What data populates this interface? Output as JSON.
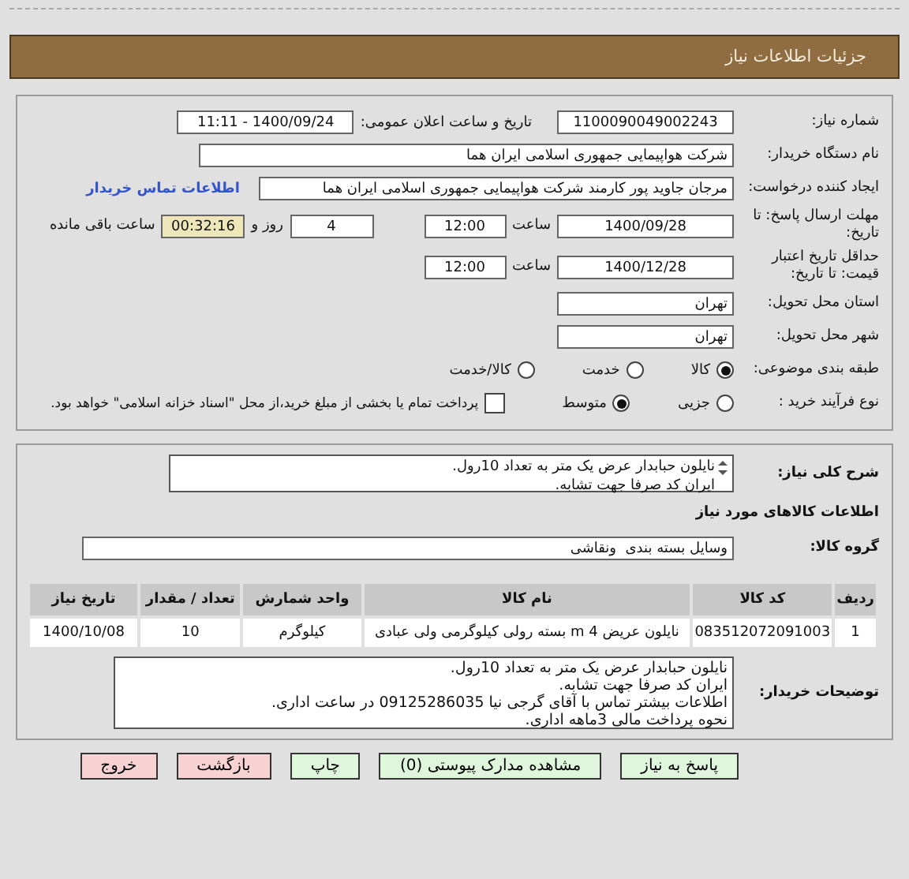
{
  "page_title": "جزئیات اطلاعات نیاز",
  "need_number": {
    "label": "شماره نیاز:",
    "value": "1100090049002243"
  },
  "announce": {
    "label": "تاریخ و ساعت اعلان عمومی:",
    "value": "1400/09/24 - 11:11"
  },
  "buyer": {
    "label": "نام دستگاه خریدار:",
    "value": "شرکت هواپیمایی جمهوری اسلامی ایران هما"
  },
  "requester": {
    "label": "ایجاد کننده درخواست:",
    "value": "مرجان جاوید پور کارمند شرکت هواپیمایی جمهوری اسلامی ایران هما",
    "link": "اطلاعات تماس خریدار"
  },
  "deadline": {
    "label": "مهلت ارسال پاسخ: تا تاریخ:",
    "date": "1400/09/28",
    "time_label": "ساعت",
    "time": "12:00",
    "days": "4",
    "days_label": "روز و",
    "remaining": "00:32:16",
    "remaining_label": "ساعت باقی مانده"
  },
  "validity": {
    "label": "حداقل تاریخ اعتبار قیمت: تا تاریخ:",
    "date": "1400/12/28",
    "time_label": "ساعت",
    "time": "12:00"
  },
  "province": {
    "label": "استان محل تحویل:",
    "value": "تهران"
  },
  "city": {
    "label": "شهر محل تحویل:",
    "value": "تهران"
  },
  "category": {
    "label": "طبقه بندی موضوعی:",
    "options": [
      {
        "label": "کالا",
        "selected": true
      },
      {
        "label": "خدمت",
        "selected": false
      },
      {
        "label": "کالا/خدمت",
        "selected": false
      }
    ]
  },
  "process": {
    "label": "نوع فرآیند خرید :",
    "options": [
      {
        "label": "جزیی",
        "selected": false
      },
      {
        "label": "متوسط",
        "selected": true
      }
    ],
    "payment": {
      "checked": false,
      "text": "پرداخت تمام یا بخشی از مبلغ خرید،از محل \"اسناد خزانه اسلامی\" خواهد بود."
    }
  },
  "description": {
    "label": "شرح کلی نیاز:",
    "text": "نایلون حبابدار عرض یک متر به تعداد 10رول.\nایران کد صرفا جهت تشابه."
  },
  "goods_title": "اطلاعات کالاهای مورد نیاز",
  "goods_group": {
    "label": "گروه کالا:",
    "value": "وسایل بسته بندی  ونقاشی"
  },
  "table": {
    "columns": [
      "ردیف",
      "کد کالا",
      "نام کالا",
      "واحد شمارش",
      "تعداد / مقدار",
      "تاریخ نیاز"
    ],
    "rows": [
      [
        "1",
        "083512072091003",
        "نایلون عریض 4 m بسته رولی کیلوگرمی ولی عبادی",
        "کیلوگرم",
        "10",
        "1400/10/08"
      ]
    ]
  },
  "buyer_notes": {
    "label": "توضیحات خریدار:",
    "text": "نایلون حبابدار عرض یک متر به تعداد 10رول.\nایران کد صرفا جهت تشابه.\nاطلاعات بیشتر تماس با آقای گرجی نیا 09125286035 در ساعت اداری.\nنحوه پرداخت مالی 3ماهه اداری."
  },
  "buttons": [
    {
      "label": "پاسخ به نیاز",
      "kind": "action"
    },
    {
      "label": "مشاهده مدارک پیوستی (0)",
      "kind": "action"
    },
    {
      "label": "چاپ",
      "kind": "action"
    },
    {
      "label": "بازگشت",
      "kind": "exit"
    },
    {
      "label": "خروج",
      "kind": "exit"
    }
  ]
}
